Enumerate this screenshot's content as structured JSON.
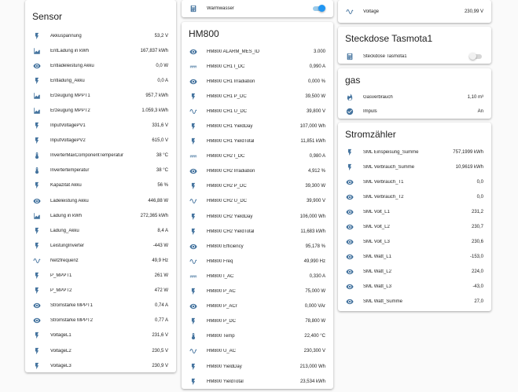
{
  "accent_color": "#44739e",
  "sensor": {
    "title": "Sensor",
    "rows": [
      {
        "icon": "flash-icon",
        "label": "Akkuspannung",
        "value": "53,2 V"
      },
      {
        "icon": "chart-area-icon",
        "label": "EntLadung in kWh",
        "value": "167,837 kWh"
      },
      {
        "icon": "eye-icon",
        "label": "Entladeleistung Akku",
        "value": "0,0 W"
      },
      {
        "icon": "flash-icon",
        "label": "Entladung_Akku",
        "value": "0,0 A"
      },
      {
        "icon": "chart-area-icon",
        "label": "Erzeugung MPPT1",
        "value": "957,7 kWh"
      },
      {
        "icon": "chart-area-icon",
        "label": "Erzeugung MPPT2",
        "value": "1.059,3 kWh"
      },
      {
        "icon": "flash-icon",
        "label": "InputVoltagePV1",
        "value": "331,6 V"
      },
      {
        "icon": "flash-icon",
        "label": "InputVoltagePV2",
        "value": "615,0 V"
      },
      {
        "icon": "thermometer-icon",
        "label": "InverterMaxComponentTemperatur",
        "value": "38 °C"
      },
      {
        "icon": "thermometer-icon",
        "label": "Invertertemperatur",
        "value": "38 °C"
      },
      {
        "icon": "flash-icon",
        "label": "Kapazität Akku",
        "value": "56 %"
      },
      {
        "icon": "eye-icon",
        "label": "Ladeleistung Akku",
        "value": "446,88 W"
      },
      {
        "icon": "chart-area-icon",
        "label": "Ladung in kWh",
        "value": "272,365 kWh"
      },
      {
        "icon": "flash-icon",
        "label": "Ladung_Akku",
        "value": "8,4 A"
      },
      {
        "icon": "flash-icon",
        "label": "LeistungInverter",
        "value": "-443 W"
      },
      {
        "icon": "sine-wave-icon",
        "label": "Netzfrequenz",
        "value": "49,9 Hz"
      },
      {
        "icon": "flash-icon",
        "label": "P_MPPT1",
        "value": "261 W"
      },
      {
        "icon": "flash-icon",
        "label": "P_MPPT2",
        "value": "472 W"
      },
      {
        "icon": "eye-icon",
        "label": "Stromstärke MPPT1",
        "value": "0,74 A"
      },
      {
        "icon": "eye-icon",
        "label": "Stromstärke MPPT2",
        "value": "0,77 A"
      },
      {
        "icon": "flash-icon",
        "label": "VoltageL1",
        "value": "231,6 V"
      },
      {
        "icon": "flash-icon",
        "label": "VoltageL2",
        "value": "230,5 V"
      },
      {
        "icon": "flash-icon",
        "label": "VoltageL3",
        "value": "230,9 V"
      }
    ]
  },
  "warmwasser": {
    "icon": "calculator-icon",
    "label": "Warmwasser",
    "state": "on"
  },
  "hm800": {
    "title": "HM800",
    "rows": [
      {
        "icon": "eye-icon",
        "label": "HM800 ALARM_MES_ID",
        "value": "3.000"
      },
      {
        "icon": "current-dc-icon",
        "label": "HM800 CH1 I_DC",
        "value": "0,990 A"
      },
      {
        "icon": "eye-icon",
        "label": "HM800 CH1 Irradiation",
        "value": "0,000 %"
      },
      {
        "icon": "flash-icon",
        "label": "HM800 CH1 P_DC",
        "value": "39,500 W"
      },
      {
        "icon": "sine-wave-icon",
        "label": "HM800 CH1 U_DC",
        "value": "39,800 V"
      },
      {
        "icon": "flash-icon",
        "label": "HM800 CH1 YieldDay",
        "value": "107,000 Wh"
      },
      {
        "icon": "flash-icon",
        "label": "HM800 CH1 YieldTotal",
        "value": "11,851 kWh"
      },
      {
        "icon": "current-dc-icon",
        "label": "HM800 CH2 I_DC",
        "value": "0,980 A"
      },
      {
        "icon": "eye-icon",
        "label": "HM800 CH2 Irradiation",
        "value": "4,912 %"
      },
      {
        "icon": "flash-icon",
        "label": "HM800 CH2 P_DC",
        "value": "39,300 W"
      },
      {
        "icon": "sine-wave-icon",
        "label": "HM800 CH2 U_DC",
        "value": "39,900 V"
      },
      {
        "icon": "flash-icon",
        "label": "HM800 CH2 YieldDay",
        "value": "106,000 Wh"
      },
      {
        "icon": "flash-icon",
        "label": "HM800 CH2 YieldTotal",
        "value": "11,683 kWh"
      },
      {
        "icon": "eye-icon",
        "label": "HM800 Efficiency",
        "value": "95,178 %"
      },
      {
        "icon": "sine-wave-icon",
        "label": "HM800 Freq",
        "value": "49,990 Hz"
      },
      {
        "icon": "current-dc-icon",
        "label": "HM800 I_AC",
        "value": "0,330 A"
      },
      {
        "icon": "flash-icon",
        "label": "HM800 P_AC",
        "value": "75,000 W"
      },
      {
        "icon": "eye-icon",
        "label": "HM800 P_ACr",
        "value": "0,000 VAr"
      },
      {
        "icon": "flash-icon",
        "label": "HM800 P_DC",
        "value": "78,800 W"
      },
      {
        "icon": "thermometer-icon",
        "label": "HM800 Temp",
        "value": "22,400 °C"
      },
      {
        "icon": "sine-wave-icon",
        "label": "HM800 U_AC",
        "value": "230,300 V"
      },
      {
        "icon": "flash-icon",
        "label": "HM800 YieldDay",
        "value": "213,000 Wh"
      },
      {
        "icon": "flash-icon",
        "label": "HM800 YieldTotal",
        "value": "23,534 kWh"
      }
    ]
  },
  "voltage_card": {
    "icon": "sine-wave-icon",
    "label": "Voltage",
    "value": "230,99 V"
  },
  "steckdose": {
    "title": "Steckdose Tasmota1",
    "icon": "calculator-icon",
    "label": "Steckdose Tasmota1",
    "state": "off"
  },
  "gas": {
    "title": "gas",
    "rows": [
      {
        "icon": "fire-icon",
        "label": "Gasverbrauch",
        "value": "1,10 m³"
      },
      {
        "icon": "check-circle-icon",
        "label": "Impuls",
        "value": "An"
      }
    ]
  },
  "stromzaehler": {
    "title": "Stromzähler",
    "rows": [
      {
        "icon": "flash-icon",
        "label": "SML Einspeisung_Summe",
        "value": "757,1999 kWh"
      },
      {
        "icon": "flash-icon",
        "label": "SML Verbrauch_Summe",
        "value": "10,9619 kWh"
      },
      {
        "icon": "eye-icon",
        "label": "SML Verbrauch_T1",
        "value": "0,0"
      },
      {
        "icon": "eye-icon",
        "label": "SML Verbrauch_T2",
        "value": "0,0"
      },
      {
        "icon": "eye-icon",
        "label": "SML Volt_L1",
        "value": "231,2"
      },
      {
        "icon": "eye-icon",
        "label": "SML Volt_L2",
        "value": "230,7"
      },
      {
        "icon": "eye-icon",
        "label": "SML Volt_L3",
        "value": "230,6"
      },
      {
        "icon": "eye-icon",
        "label": "SML Watt_L1",
        "value": "-153,0"
      },
      {
        "icon": "eye-icon",
        "label": "SML Watt_L2",
        "value": "224,0"
      },
      {
        "icon": "eye-icon",
        "label": "SML Watt_L3",
        "value": "-43,0"
      },
      {
        "icon": "eye-icon",
        "label": "SML Watt_Summe",
        "value": "27,0"
      }
    ]
  }
}
